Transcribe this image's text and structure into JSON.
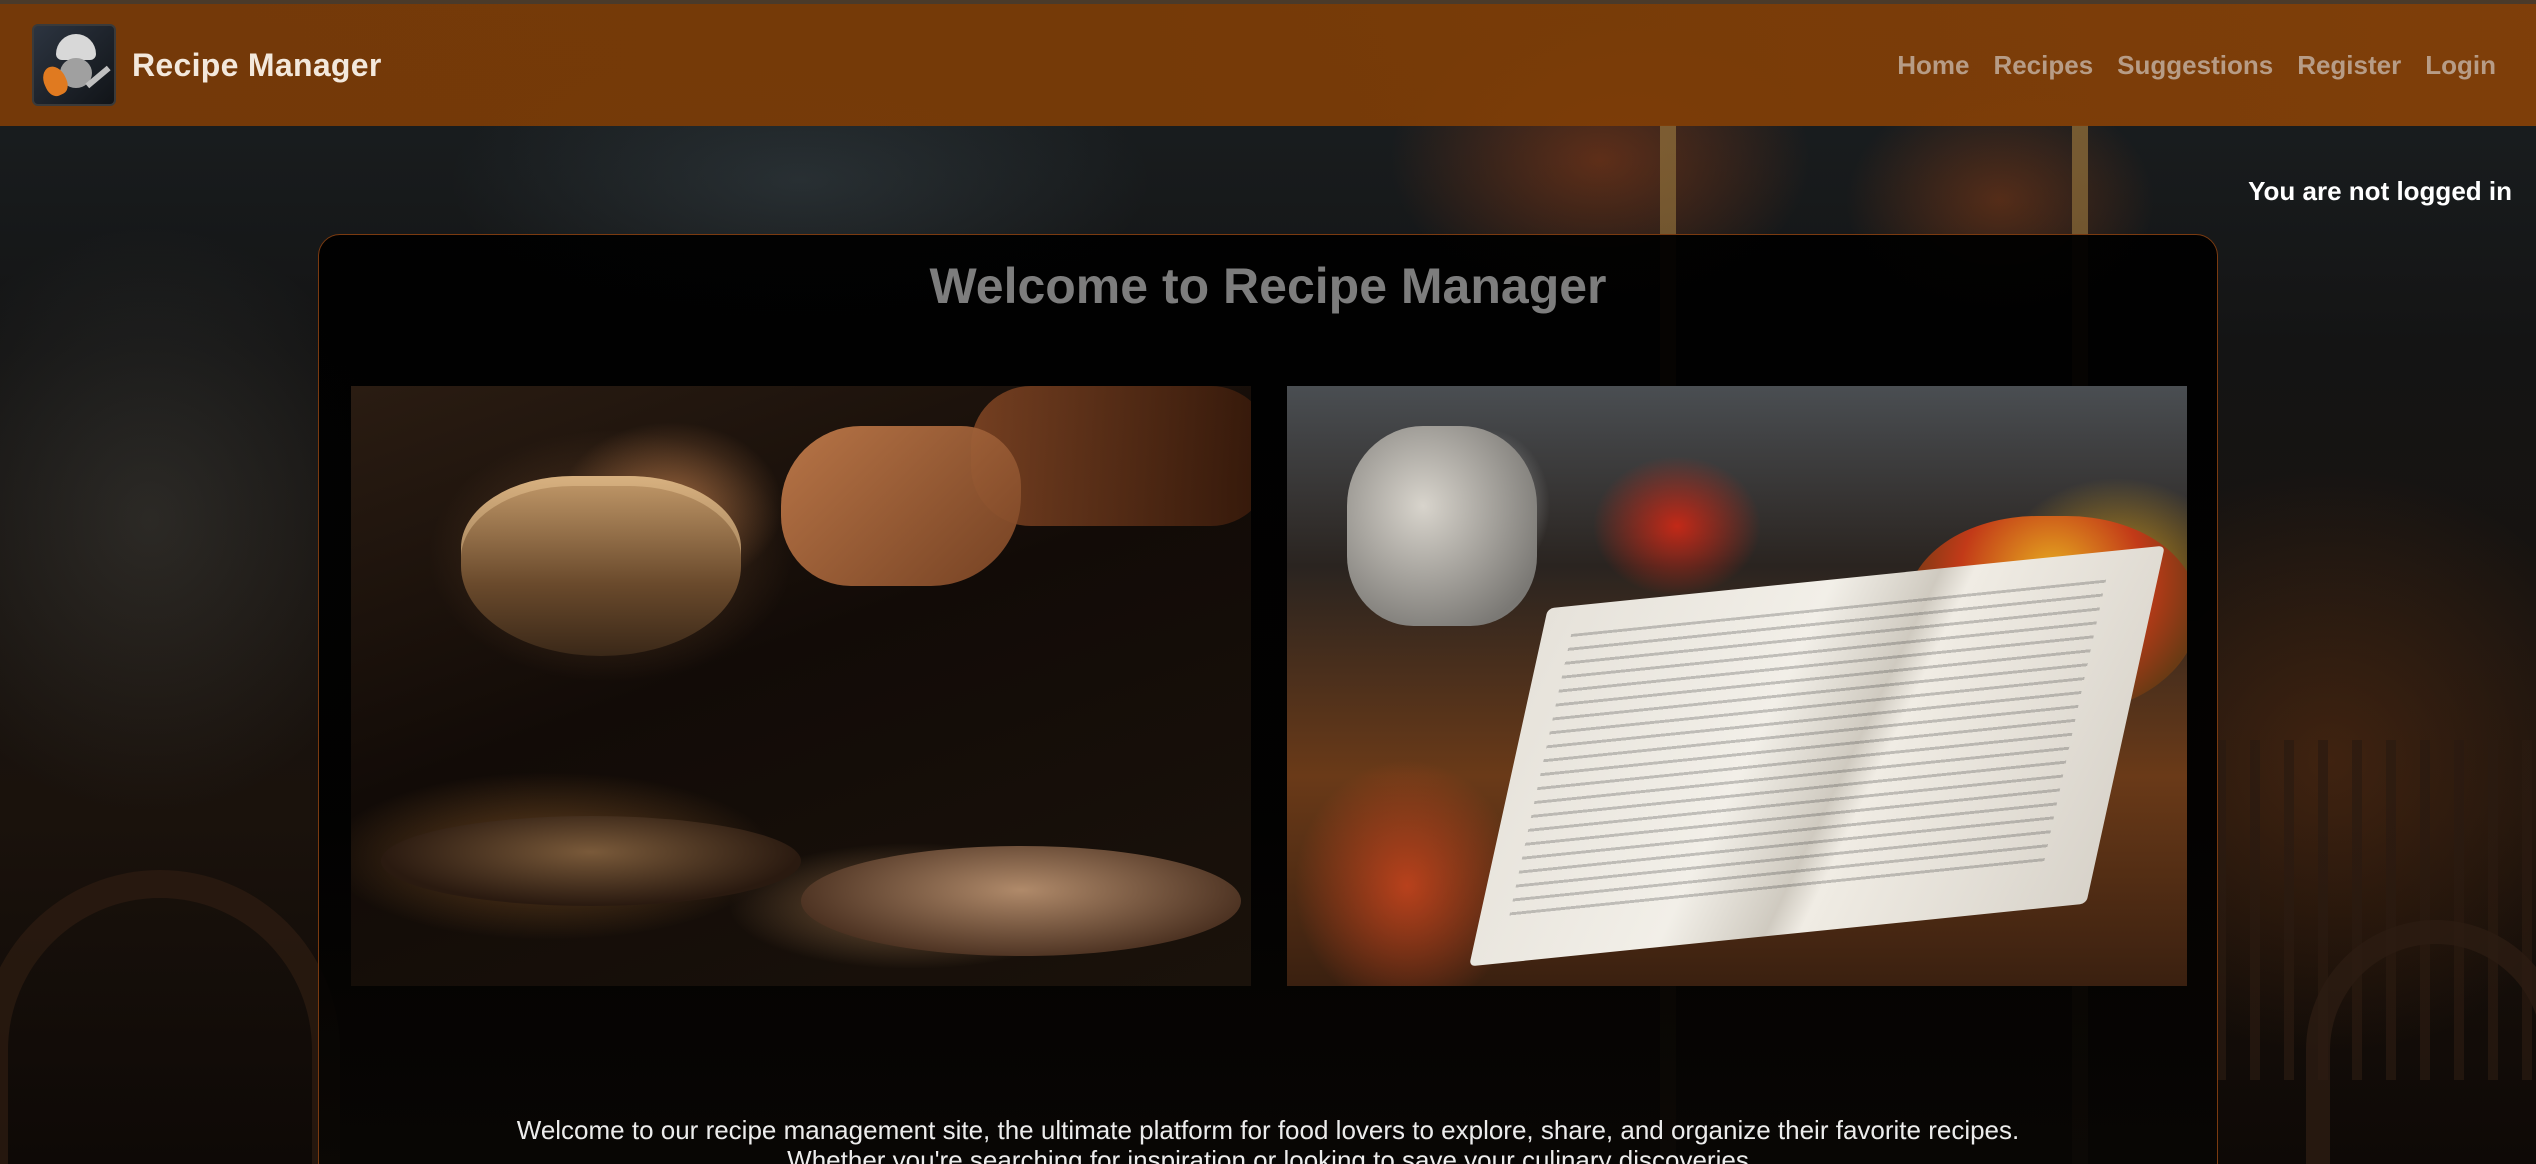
{
  "app": {
    "title": "Recipe Manager"
  },
  "nav": {
    "links": [
      {
        "label": "Home"
      },
      {
        "label": "Recipes"
      },
      {
        "label": "Suggestions"
      },
      {
        "label": "Register"
      },
      {
        "label": "Login"
      }
    ]
  },
  "status": {
    "login_text": "You are not logged in"
  },
  "main": {
    "heading": "Welcome to Recipe Manager",
    "intro_text": "Welcome to our recipe management site, the ultimate platform for food lovers to explore, share, and organize their favorite recipes. Whether you're searching for inspiration or looking to save your culinary discoveries"
  },
  "colors": {
    "navbar": "#7c3c06",
    "card_border": "#7a3a10",
    "heading": "#7d7d7d",
    "nav_link": "#b79c86"
  }
}
